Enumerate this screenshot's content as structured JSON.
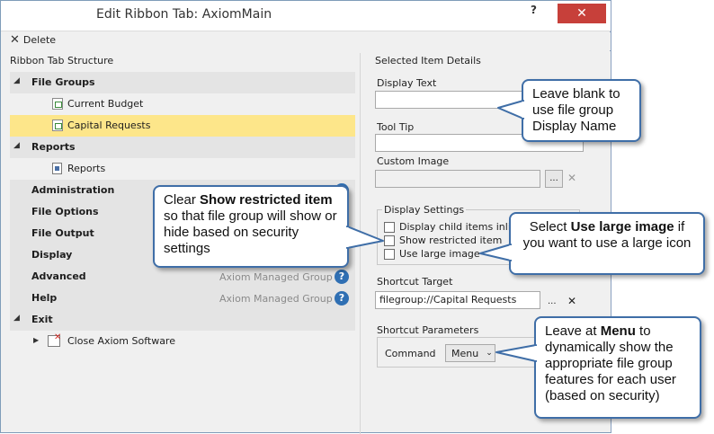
{
  "window": {
    "title": "Edit Ribbon Tab: AxiomMain",
    "help_glyph": "?",
    "close_glyph": "✕"
  },
  "toolbar": {
    "delete_label": "Delete"
  },
  "left_panel": {
    "label": "Ribbon Tab Structure",
    "tree": [
      {
        "label": "File Groups",
        "type": "group",
        "expanded": true
      },
      {
        "label": "Current Budget",
        "type": "file"
      },
      {
        "label": "Capital Requests",
        "type": "file",
        "selected": true
      },
      {
        "label": "Reports",
        "type": "group",
        "expanded": true
      },
      {
        "label": "Reports",
        "type": "doc"
      },
      {
        "label": "Administration",
        "type": "group"
      },
      {
        "label": "File Options",
        "type": "group"
      },
      {
        "label": "File Output",
        "type": "group"
      },
      {
        "label": "Display",
        "type": "group"
      },
      {
        "label": "Advanced",
        "type": "group",
        "managed": "Axiom Managed Group"
      },
      {
        "label": "Help",
        "type": "group",
        "managed": "Axiom Managed Group"
      },
      {
        "label": "Exit",
        "type": "group",
        "expanded": true
      },
      {
        "label": "Close Axiom Software",
        "type": "exit"
      }
    ]
  },
  "right_panel": {
    "label": "Selected Item Details",
    "display_text_label": "Display Text",
    "display_text_value": "",
    "tooltip_label": "Tool Tip",
    "tooltip_value": "",
    "custom_image_label": "Custom Image",
    "custom_image_value": "",
    "ellipsis": "...",
    "display_settings_label": "Display Settings",
    "checkboxes": [
      {
        "label": "Display child items inline",
        "checked": false
      },
      {
        "label": "Show restricted item",
        "checked": false
      },
      {
        "label": "Use large image",
        "checked": false
      }
    ],
    "shortcut_target_label": "Shortcut Target",
    "shortcut_target_value": "filegroup://Capital Requests",
    "shortcut_parameters_label": "Shortcut Parameters",
    "command_label": "Command",
    "command_value": "Menu"
  },
  "callouts": {
    "c1": "Leave blank to use file group Display Name",
    "c2_pre": "Clear ",
    "c2_bold": "Show restricted item",
    "c2_post": " so that file group will show or hide based on security settings",
    "c3_pre": "Select ",
    "c3_bold": "Use large image",
    "c3_post": " if you want to use a large icon",
    "c4_pre": "Leave at ",
    "c4_bold": "Menu",
    "c4_post": " to dynamically show the appropriate file group features for each user (based on security)"
  },
  "colors": {
    "selected_row": "#fde68a",
    "group_row": "#e4e4e4",
    "close_button": "#c7403a",
    "callout_border": "#3f6ea7",
    "help_icon": "#2f6fb3"
  }
}
